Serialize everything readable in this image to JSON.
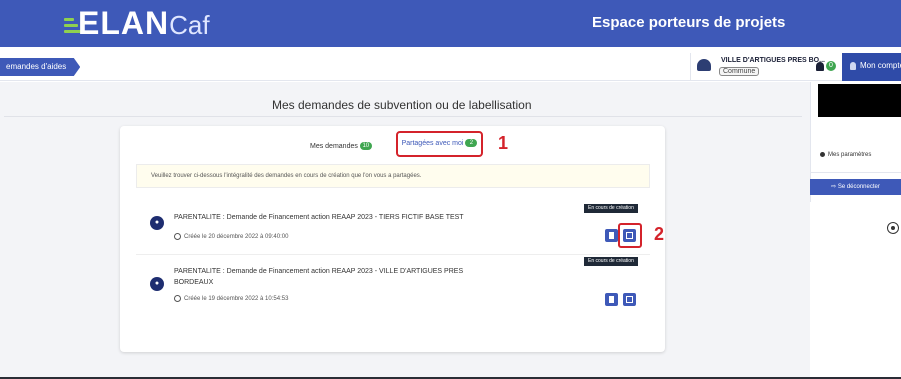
{
  "header": {
    "logo_main": "ELAN",
    "logo_caf": "Caf",
    "space_title": "Espace porteurs de projets"
  },
  "breadcrumb": {
    "label": "emandes d'aides"
  },
  "user": {
    "name": "VILLE D'ARTIGUES PRES BO...",
    "role": "Commune",
    "notifications": "0",
    "account_label": "Mon compte"
  },
  "page": {
    "title": "Mes demandes de subvention ou de labellisation"
  },
  "tabs": {
    "mine_label": "Mes demandes",
    "mine_count": "10",
    "shared_label": "Partagées avec moi",
    "shared_count": "2"
  },
  "annotations": {
    "step1": "1",
    "step2": "2"
  },
  "info_text": "Veuillez trouver ci-dessous l'intégralité des demandes en cours de création que l'on vous a partagées.",
  "requests": [
    {
      "title": "PARENTALITE : Demande de Financement action REAAP 2023 - TIERS FICTIF BASE TEST",
      "created": "Créée le 20 décembre 2022 à 09:40:00",
      "status": "En cours de création"
    },
    {
      "title_line1": "PARENTALITE : Demande de Financement action REAAP 2023 - VILLE D'ARTIGUES PRES",
      "title_line2": "BORDEAUX",
      "created": "Créée le 19 décembre 2022 à 10:54:53",
      "status": "En cours de création"
    }
  ],
  "account_menu": {
    "params_label": "Mes paramètres",
    "logout_label": "Se déconnecter"
  },
  "colors": {
    "brand_blue": "#3e59b8",
    "highlight_red": "#d4232b",
    "badge_green": "#3fa650",
    "status_dark": "#1f2937"
  }
}
